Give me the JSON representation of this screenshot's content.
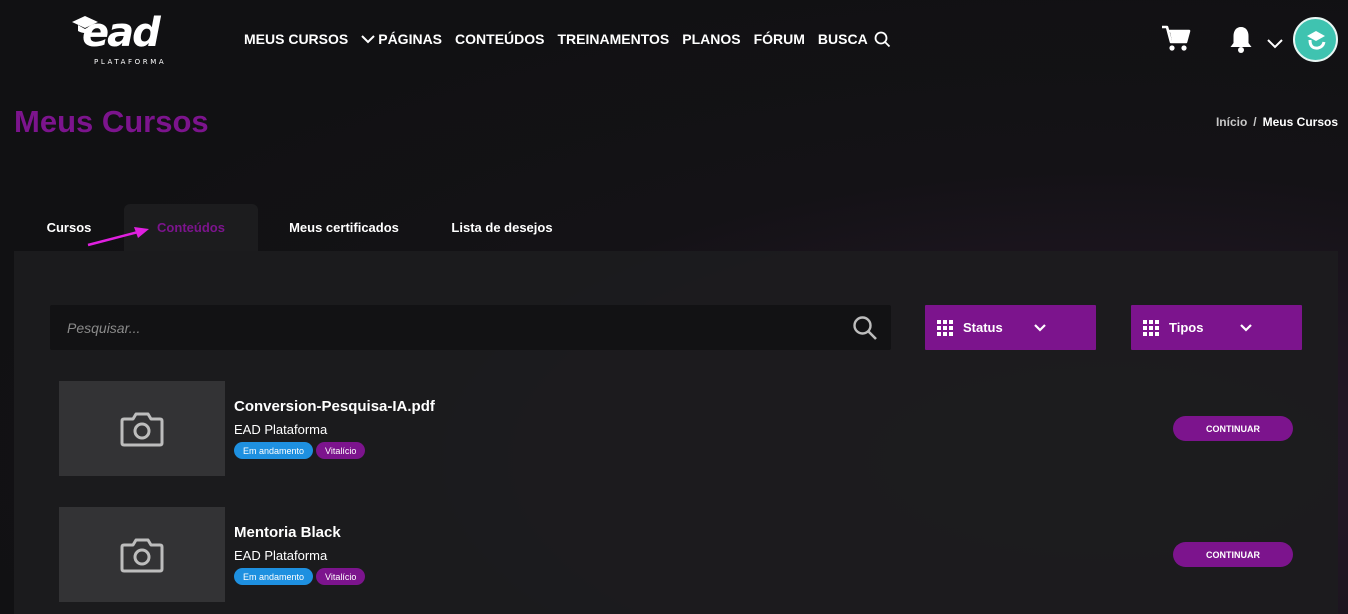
{
  "brand": {
    "logo_text": "ead",
    "logo_sub": "PLATAFORMA"
  },
  "nav": {
    "items": [
      "MEUS CURSOS",
      "PÁGINAS",
      "CONTEÚDOS",
      "TREINAMENTOS",
      "PLANOS",
      "FÓRUM",
      "BUSCA"
    ]
  },
  "header": {
    "title": "Meus Cursos"
  },
  "breadcrumb": {
    "home": "Início",
    "separator": "/",
    "current": "Meus Cursos"
  },
  "tabs": [
    {
      "label": "Cursos",
      "active": false
    },
    {
      "label": "Conteúdos",
      "active": true
    },
    {
      "label": "Meus certificados",
      "active": false
    },
    {
      "label": "Lista de desejos",
      "active": false
    }
  ],
  "search": {
    "placeholder": "Pesquisar..."
  },
  "filters": {
    "status_label": "Status",
    "tipos_label": "Tipos"
  },
  "courses": [
    {
      "title": "Conversion-Pesquisa-IA.pdf",
      "author": "EAD Plataforma",
      "status_badge": "Em andamento",
      "access_badge": "Vitalício",
      "button": "CONTINUAR"
    },
    {
      "title": "Mentoria Black",
      "author": "EAD Plataforma",
      "status_badge": "Em andamento",
      "access_badge": "Vitalício",
      "button": "CONTINUAR"
    }
  ],
  "colors": {
    "accent": "#7c148d",
    "status_badge": "#1e90e0",
    "annotation_arrow": "#e020e0",
    "avatar": "#3fc3b0"
  },
  "icons": [
    "graduation-cap-icon",
    "chevron-down-icon",
    "search-icon",
    "cart-icon",
    "bell-icon",
    "grid-icon",
    "camera-icon"
  ]
}
